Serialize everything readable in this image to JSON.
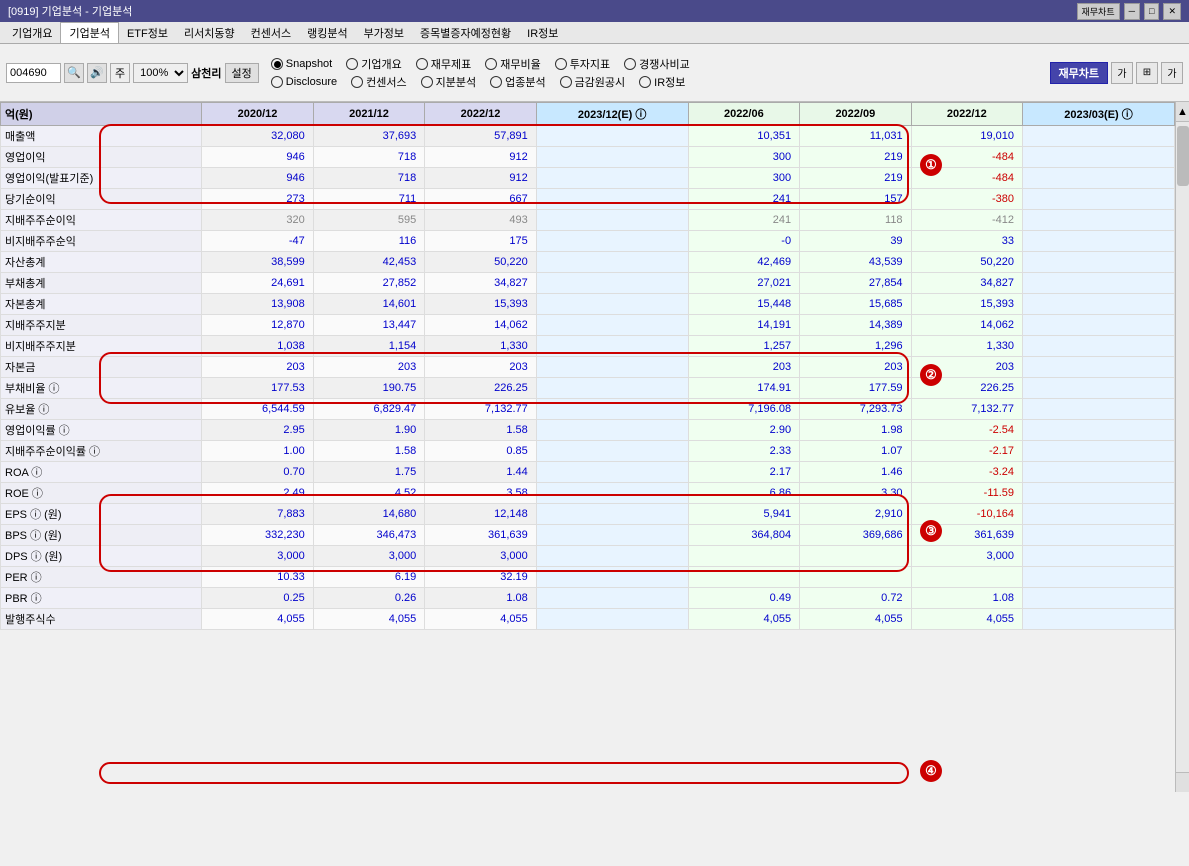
{
  "titlebar": {
    "text": "[0919] 기업분석 - 기업분석",
    "buttons": [
      "재무차트",
      "□",
      "✕"
    ]
  },
  "menubar": {
    "items": [
      "기업개요",
      "기업분석",
      "ETF정보",
      "리서치동향",
      "컨센서스",
      "랭킹분석",
      "부가정보",
      "증목별증자예정현황",
      "IR정보"
    ]
  },
  "toolbar": {
    "ticker": "004690",
    "percent": "100%",
    "company": "삼천리",
    "set_btn": "설정",
    "chart_btn": "재무차트",
    "radio_options": [
      {
        "id": "snapshot",
        "label": "Snapshot",
        "selected": true
      },
      {
        "id": "company",
        "label": "기업개요",
        "selected": false
      },
      {
        "id": "financial",
        "label": "재무제표",
        "selected": false
      },
      {
        "id": "ratio",
        "label": "재무비율",
        "selected": false
      },
      {
        "id": "investment",
        "label": "투자지표",
        "selected": false
      },
      {
        "id": "competitive",
        "label": "경쟁사비교",
        "selected": false
      },
      {
        "id": "disclosure",
        "label": "Disclosure",
        "selected": false
      },
      {
        "id": "consensus",
        "label": "컨센서스",
        "selected": false
      },
      {
        "id": "equity",
        "label": "지분분석",
        "selected": false
      },
      {
        "id": "industry",
        "label": "업종분석",
        "selected": false
      },
      {
        "id": "fss",
        "label": "금감원공시",
        "selected": false
      },
      {
        "id": "ir",
        "label": "IR정보",
        "selected": false
      }
    ]
  },
  "table": {
    "unit_label": "억(원)",
    "columns": [
      {
        "label": "2020/12",
        "type": "annual"
      },
      {
        "label": "2021/12",
        "type": "annual"
      },
      {
        "label": "2022/12",
        "type": "annual"
      },
      {
        "label": "2023/12(E)",
        "type": "estimate"
      },
      {
        "label": "2022/06",
        "type": "quarter"
      },
      {
        "label": "2022/09",
        "type": "quarter"
      },
      {
        "label": "2022/12",
        "type": "quarter"
      },
      {
        "label": "2023/03(E)",
        "type": "estimate"
      }
    ],
    "rows": [
      {
        "label": "매출액",
        "values": [
          "32,080",
          "37,693",
          "57,891",
          "",
          "10,351",
          "11,031",
          "19,010",
          ""
        ],
        "colors": [
          "blue",
          "blue",
          "blue",
          "",
          "blue",
          "blue",
          "blue",
          ""
        ]
      },
      {
        "label": "영업이익",
        "values": [
          "946",
          "718",
          "912",
          "",
          "300",
          "219",
          "-484",
          ""
        ],
        "colors": [
          "blue",
          "blue",
          "blue",
          "",
          "blue",
          "blue",
          "red",
          ""
        ]
      },
      {
        "label": "영업이익(발표기준)",
        "values": [
          "946",
          "718",
          "912",
          "",
          "300",
          "219",
          "-484",
          ""
        ],
        "colors": [
          "blue",
          "blue",
          "blue",
          "",
          "blue",
          "blue",
          "red",
          ""
        ]
      },
      {
        "label": "당기순이익",
        "values": [
          "273",
          "711",
          "667",
          "",
          "241",
          "157",
          "-380",
          ""
        ],
        "colors": [
          "blue",
          "blue",
          "blue",
          "",
          "blue",
          "blue",
          "red",
          ""
        ]
      },
      {
        "label": "지배주주순이익",
        "values": [
          "320",
          "595",
          "493",
          "",
          "241",
          "118",
          "-412",
          ""
        ],
        "colors": [
          "gray",
          "gray",
          "gray",
          "",
          "gray",
          "gray",
          "gray",
          ""
        ]
      },
      {
        "label": "비지배주주순익",
        "values": [
          "-47",
          "116",
          "175",
          "",
          "-0",
          "39",
          "33",
          ""
        ],
        "colors": [
          "blue",
          "blue",
          "blue",
          "",
          "blue",
          "blue",
          "blue",
          ""
        ]
      },
      {
        "label": "자산총계",
        "values": [
          "38,599",
          "42,453",
          "50,220",
          "",
          "42,469",
          "43,539",
          "50,220",
          ""
        ],
        "colors": [
          "blue",
          "blue",
          "blue",
          "",
          "blue",
          "blue",
          "blue",
          ""
        ]
      },
      {
        "label": "부채총계",
        "values": [
          "24,691",
          "27,852",
          "34,827",
          "",
          "27,021",
          "27,854",
          "34,827",
          ""
        ],
        "colors": [
          "blue",
          "blue",
          "blue",
          "",
          "blue",
          "blue",
          "blue",
          ""
        ]
      },
      {
        "label": "자본총계",
        "values": [
          "13,908",
          "14,601",
          "15,393",
          "",
          "15,448",
          "15,685",
          "15,393",
          ""
        ],
        "colors": [
          "blue",
          "blue",
          "blue",
          "",
          "blue",
          "blue",
          "blue",
          ""
        ]
      },
      {
        "label": "지배주주지분",
        "values": [
          "12,870",
          "13,447",
          "14,062",
          "",
          "14,191",
          "14,389",
          "14,062",
          ""
        ],
        "colors": [
          "blue",
          "blue",
          "blue",
          "",
          "blue",
          "blue",
          "blue",
          ""
        ]
      },
      {
        "label": "비지배주주지분",
        "values": [
          "1,038",
          "1,154",
          "1,330",
          "",
          "1,257",
          "1,296",
          "1,330",
          ""
        ],
        "colors": [
          "blue",
          "blue",
          "blue",
          "",
          "blue",
          "blue",
          "blue",
          ""
        ]
      },
      {
        "label": "자본금",
        "values": [
          "203",
          "203",
          "203",
          "",
          "203",
          "203",
          "203",
          ""
        ],
        "colors": [
          "blue",
          "blue",
          "blue",
          "",
          "blue",
          "blue",
          "blue",
          ""
        ]
      },
      {
        "label": "부채비율",
        "values": [
          "177.53",
          "190.75",
          "226.25",
          "",
          "174.91",
          "177.59",
          "226.25",
          ""
        ],
        "colors": [
          "blue",
          "blue",
          "blue",
          "",
          "blue",
          "blue",
          "blue",
          ""
        ],
        "note": true
      },
      {
        "label": "유보율",
        "values": [
          "6,544.59",
          "6,829.47",
          "7,132.77",
          "",
          "7,196.08",
          "7,293.73",
          "7,132.77",
          ""
        ],
        "colors": [
          "blue",
          "blue",
          "blue",
          "",
          "blue",
          "blue",
          "blue",
          ""
        ],
        "note": true
      },
      {
        "label": "영업이익률",
        "values": [
          "2.95",
          "1.90",
          "1.58",
          "",
          "2.90",
          "1.98",
          "-2.54",
          ""
        ],
        "colors": [
          "blue",
          "blue",
          "blue",
          "",
          "blue",
          "blue",
          "red",
          ""
        ],
        "note": true
      },
      {
        "label": "지배주주순이익률",
        "values": [
          "1.00",
          "1.58",
          "0.85",
          "",
          "2.33",
          "1.07",
          "-2.17",
          ""
        ],
        "colors": [
          "blue",
          "blue",
          "blue",
          "",
          "blue",
          "blue",
          "red",
          ""
        ],
        "note": true
      },
      {
        "label": "ROA",
        "values": [
          "0.70",
          "1.75",
          "1.44",
          "",
          "2.17",
          "1.46",
          "-3.24",
          ""
        ],
        "colors": [
          "blue",
          "blue",
          "blue",
          "",
          "blue",
          "blue",
          "red",
          ""
        ],
        "note": true
      },
      {
        "label": "ROE",
        "values": [
          "2.49",
          "4.52",
          "3.58",
          "",
          "6.86",
          "3.30",
          "-11.59",
          ""
        ],
        "colors": [
          "blue",
          "blue",
          "blue",
          "",
          "blue",
          "blue",
          "red",
          ""
        ],
        "note": true
      },
      {
        "label": "EPS",
        "unit": "(원)",
        "values": [
          "7,883",
          "14,680",
          "12,148",
          "",
          "5,941",
          "2,910",
          "-10,164",
          ""
        ],
        "colors": [
          "blue",
          "blue",
          "blue",
          "",
          "blue",
          "blue",
          "red",
          ""
        ],
        "note": true
      },
      {
        "label": "BPS",
        "unit": "(원)",
        "values": [
          "332,230",
          "346,473",
          "361,639",
          "",
          "364,804",
          "369,686",
          "361,639",
          ""
        ],
        "colors": [
          "blue",
          "blue",
          "blue",
          "",
          "blue",
          "blue",
          "blue",
          ""
        ],
        "note": true
      },
      {
        "label": "DPS",
        "unit": "(원)",
        "values": [
          "3,000",
          "3,000",
          "3,000",
          "",
          "",
          "",
          "3,000",
          ""
        ],
        "colors": [
          "blue",
          "blue",
          "blue",
          "",
          "",
          "",
          "blue",
          ""
        ],
        "note": true
      },
      {
        "label": "PER",
        "values": [
          "10.33",
          "6.19",
          "32.19",
          "",
          "",
          "",
          "",
          ""
        ],
        "colors": [
          "blue",
          "blue",
          "blue",
          "",
          "",
          "",
          "",
          ""
        ],
        "note": true
      },
      {
        "label": "PBR",
        "values": [
          "0.25",
          "0.26",
          "1.08",
          "",
          "0.49",
          "0.72",
          "1.08",
          ""
        ],
        "colors": [
          "blue",
          "blue",
          "blue",
          "",
          "blue",
          "blue",
          "blue",
          ""
        ],
        "note": true
      },
      {
        "label": "발행주식수",
        "values": [
          "4,055",
          "4,055",
          "4,055",
          "",
          "4,055",
          "4,055",
          "4,055",
          ""
        ],
        "colors": [
          "blue",
          "blue",
          "blue",
          "",
          "blue",
          "blue",
          "blue",
          ""
        ]
      }
    ]
  },
  "annotations": [
    {
      "number": "①",
      "description": "매출액~당기순이익 highlight"
    },
    {
      "number": "②",
      "description": "부채비율~유보율 highlight"
    },
    {
      "number": "③",
      "description": "ROA~EPS highlight"
    },
    {
      "number": "④",
      "description": "발행주식수 highlight"
    }
  ]
}
